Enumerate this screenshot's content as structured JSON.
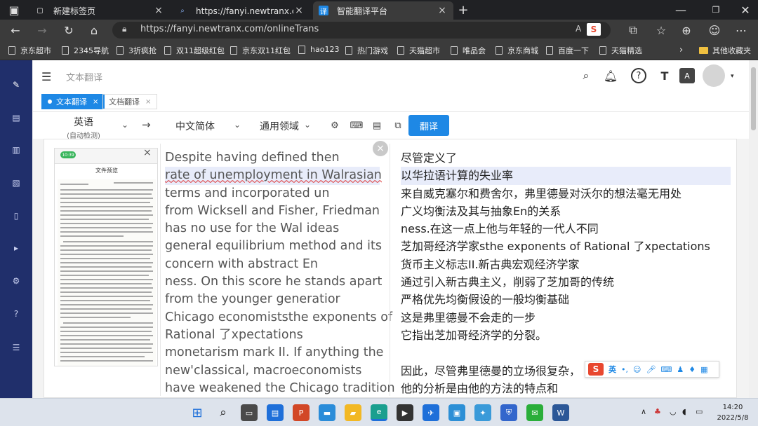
{
  "browser": {
    "tabs": [
      {
        "label": "新建标签页",
        "icon": "new-tab-icon"
      },
      {
        "label": "https://fanyi.newtranx.com - 搜索",
        "icon": "search-icon"
      },
      {
        "label": "智能翻译平台",
        "icon": "translate-icon"
      }
    ],
    "url": "https://fanyi.newtranx.com/onlineTrans",
    "bookmarks": [
      "京东超市",
      "2345导航",
      "3折疯抢",
      "双11超级红包",
      "京东双11红包",
      "hao123",
      "热门游戏",
      "天猫超市",
      "唯品会",
      "京东商城",
      "百度一下",
      "天猫精选"
    ],
    "other_bookmarks": "其他收藏夹"
  },
  "app": {
    "header_title": "文本翻译",
    "page_tabs": [
      {
        "label": "文本翻译",
        "active": true
      },
      {
        "label": "文档翻译",
        "active": false
      }
    ],
    "source_lang": "英语",
    "source_lang_sub": "(自动检测)",
    "target_lang": "中文简体",
    "domain": "通用领域",
    "translate_button": "翻译",
    "thumbnail": {
      "badge": "10:39",
      "title": "文件预览"
    },
    "source_lines": [
      "Despite having defined then",
      "rate of unemployment in Walrasian",
      "terms and incorporated un",
      "from Wicksell and Fisher,  Friedman",
      "has no use for the Wal ideas",
      "general equilibrium method and its",
      "concern with abstract En",
      "ness. On this score he stands apart",
      "from the younger generatior",
      "Chicago economiststhe exponents of",
      "Rational 了xpectations",
      "monetarism mark II. If anything the",
      "new'classical,  macroeconomists",
      "have weakened the Chicago tradition"
    ],
    "target_lines": [
      "尽管定义了",
      "以华拉语计算的失业率",
      "来自威克塞尔和费舍尔，弗里德曼对沃尔的想法毫无用处",
      "广义均衡法及其与抽象En的关系",
      "ness.在这一点上他与年轻的一代人不同",
      "芝加哥经济学家sthe exponents of Rational 了xpectations",
      "货币主义标志II.新古典宏观经济学家",
      "通过引入新古典主义，削弱了芝加哥的传统",
      "严格优先均衡假设的一般均衡基础",
      "这是弗里德曼不会走的一步",
      "它指出芝加哥经济学的分裂。",
      "",
      "因此，尽管弗里德曼的立场很复杂，",
      "他的分析是由他的方法的特点和"
    ],
    "ime_label": "英"
  },
  "taskbar": {
    "time": "14:20",
    "date": "2022/5/8"
  },
  "colors": {
    "accent": "#1e88e5",
    "sidebar": "#202f6b"
  }
}
